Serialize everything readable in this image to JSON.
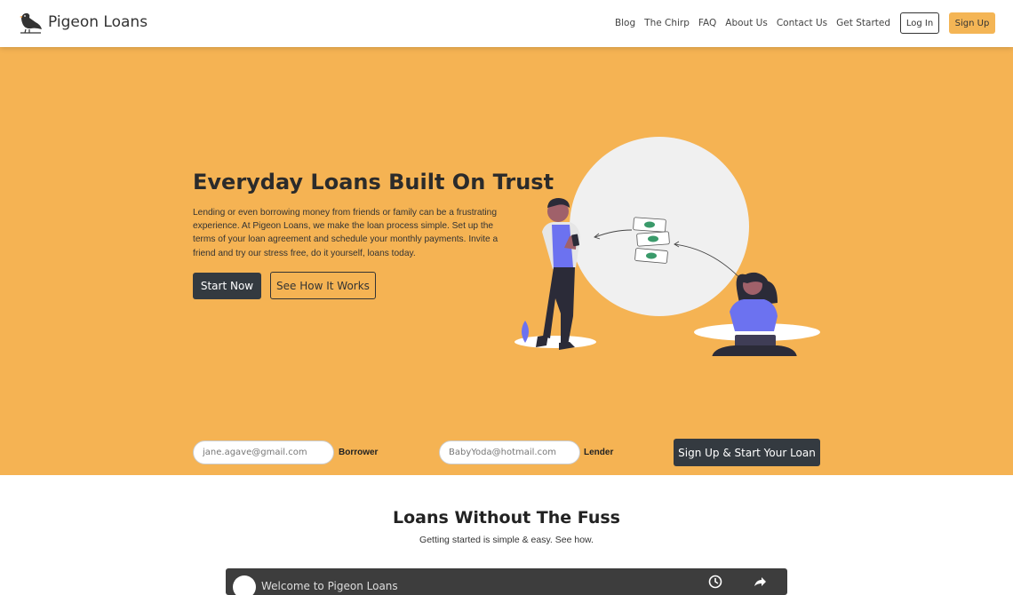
{
  "brand": {
    "name": "Pigeon Loans"
  },
  "nav": {
    "links": [
      "Blog",
      "The Chirp",
      "FAQ",
      "About Us",
      "Contact Us",
      "Get Started"
    ],
    "login_label": "Log In",
    "signup_label": "Sign Up"
  },
  "hero": {
    "title": "Everyday Loans Built On Trust",
    "description": "Lending or even borrowing money from friends or family can be a frustrating experience. At Pigeon Loans, we make the loan process simple. Set up the terms of your loan agreement and schedule your monthly payments. Invite a friend and try our stress free, do it yourself, loans today.",
    "start_label": "Start Now",
    "see_label": "See How It Works"
  },
  "signup_form": {
    "borrower_placeholder": "jane.agave@gmail.com",
    "borrower_label": "Borrower",
    "lender_placeholder": "BabyYoda@hotmail.com",
    "lender_label": "Lender",
    "submit_label": "Sign Up & Start Your Loan"
  },
  "section": {
    "title": "Loans Without The Fuss",
    "subtitle": "Getting started is simple & easy. See how."
  },
  "video": {
    "title": "Welcome to Pigeon Loans",
    "icons": [
      "clock-icon",
      "share-icon"
    ]
  },
  "colors": {
    "accent": "#f5b353",
    "dark": "#343a40",
    "figure_shirt": "#6c72f0"
  }
}
